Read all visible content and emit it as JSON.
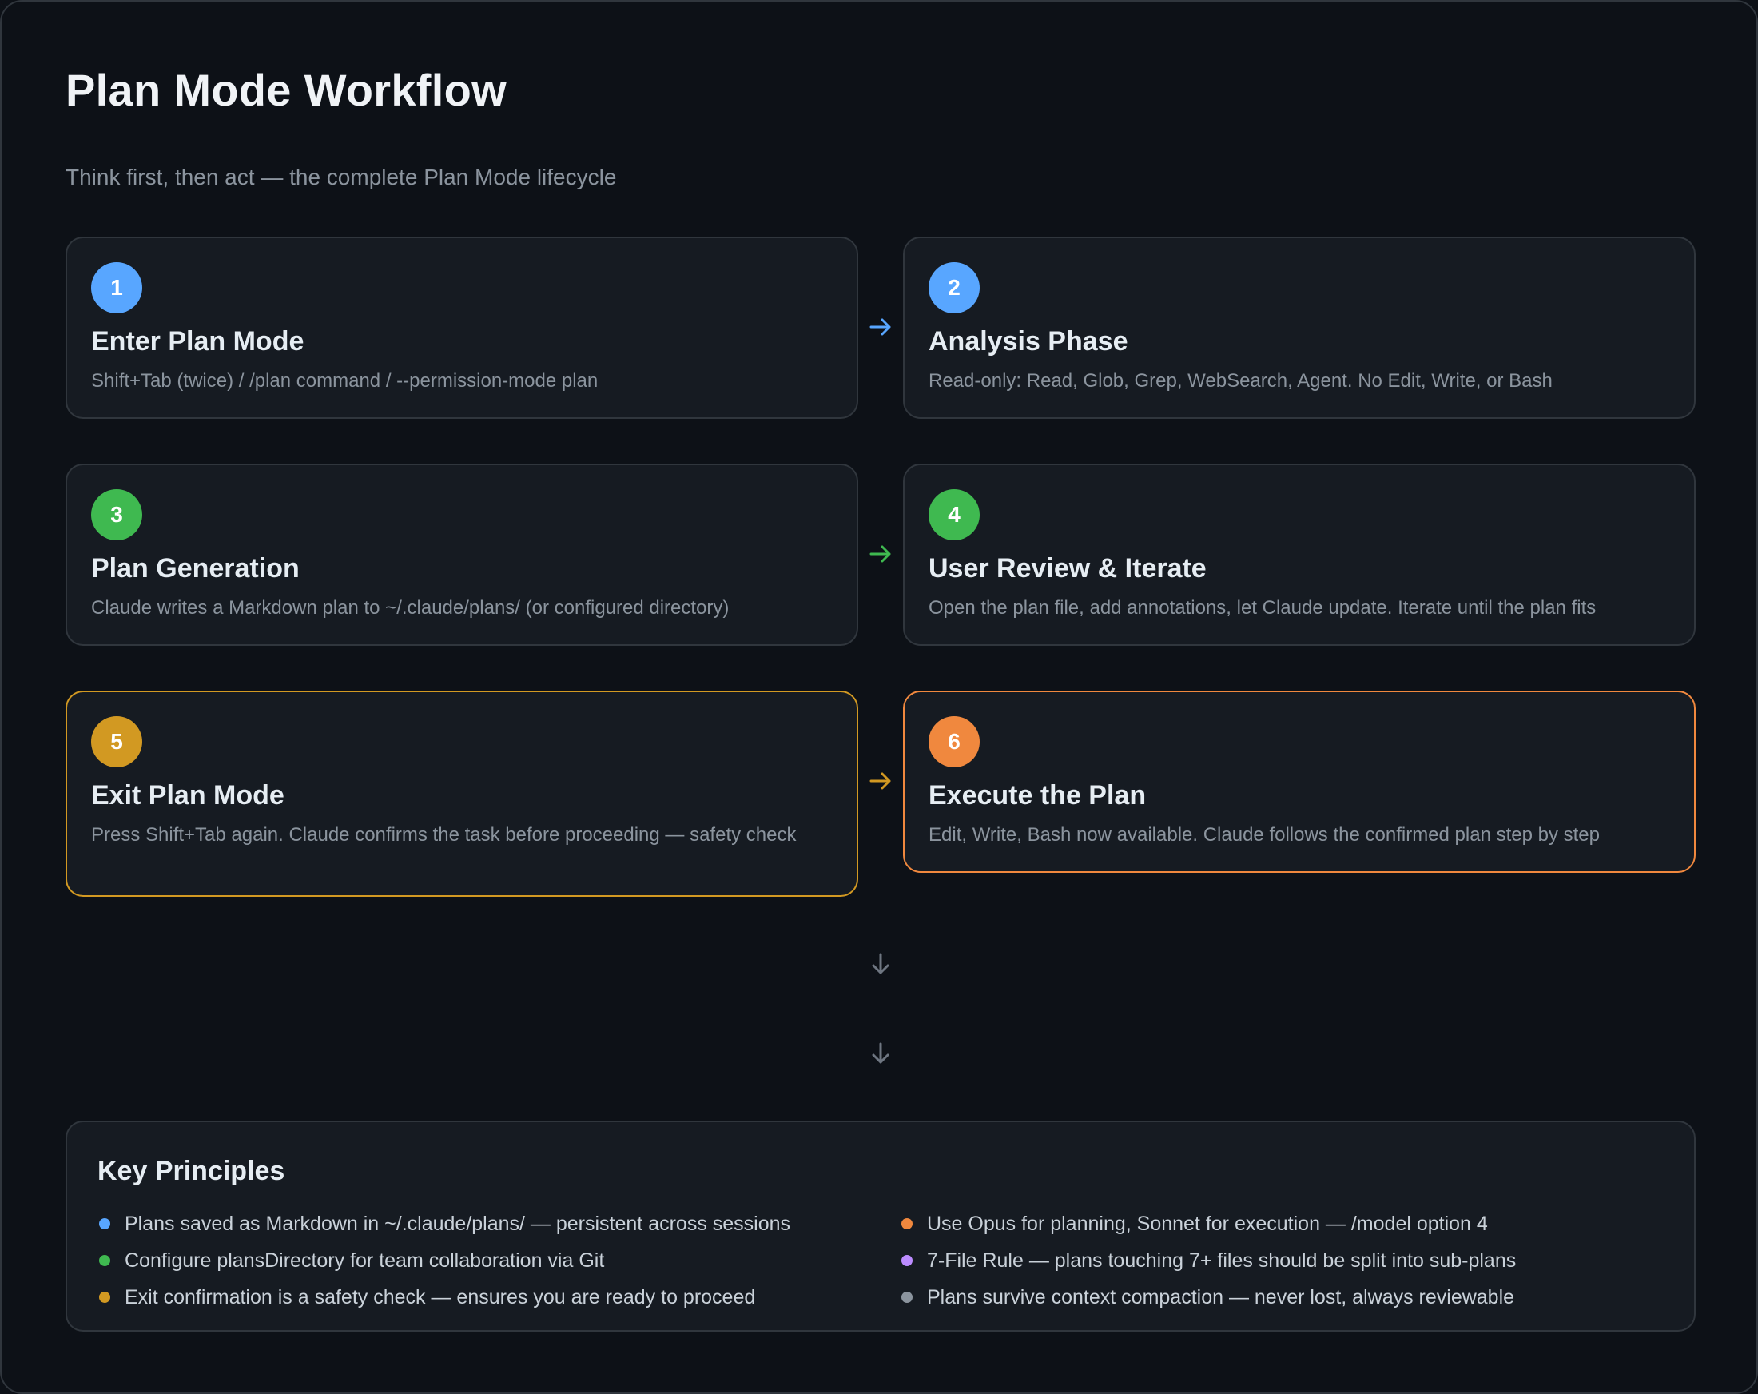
{
  "header": {
    "title": "Plan Mode Workflow",
    "subtitle": "Think first, then act — the complete Plan Mode lifecycle"
  },
  "steps": [
    {
      "number": "1",
      "title": "Enter Plan Mode",
      "description": "Shift+Tab (twice) / /plan command / --permission-mode plan",
      "color": "#58a6ff"
    },
    {
      "number": "2",
      "title": "Analysis Phase",
      "description": "Read-only: Read, Glob, Grep, WebSearch, Agent. No Edit, Write, or Bash",
      "color": "#58a6ff"
    },
    {
      "number": "3",
      "title": "Plan Generation",
      "description": "Claude writes a Markdown plan to ~/.claude/plans/ (or configured directory)",
      "color": "#3fb950"
    },
    {
      "number": "4",
      "title": "User Review & Iterate",
      "description": "Open the plan file, add annotations, let Claude update. Iterate until the plan fits",
      "color": "#3fb950"
    },
    {
      "number": "5",
      "title": "Exit Plan Mode",
      "description": "Press Shift+Tab again. Claude confirms the task before proceeding — safety check",
      "color": "#d29922"
    },
    {
      "number": "6",
      "title": "Execute the Plan",
      "description": "Edit, Write, Bash now available. Claude follows the confirmed plan step by step",
      "color": "#f0883e"
    }
  ],
  "arrow_colors": {
    "row1": "#58a6ff",
    "row2": "#3fb950",
    "row3": "#d29922",
    "down": "#6e7681"
  },
  "principles": {
    "title": "Key Principles",
    "left": [
      {
        "text": "Plans saved as Markdown in ~/.claude/plans/ — persistent across sessions",
        "color": "#58a6ff"
      },
      {
        "text": "Configure plansDirectory for team collaboration via Git",
        "color": "#3fb950"
      },
      {
        "text": "Exit confirmation is a safety check — ensures you are ready to proceed",
        "color": "#d29922"
      }
    ],
    "right": [
      {
        "text": "Use Opus for planning, Sonnet for execution — /model option 4",
        "color": "#f0883e"
      },
      {
        "text": "7-File Rule — plans touching 7+ files should be split into sub-plans",
        "color": "#bc8cff"
      },
      {
        "text": "Plans survive context compaction — never lost, always reviewable",
        "color": "#8b949e"
      }
    ]
  }
}
